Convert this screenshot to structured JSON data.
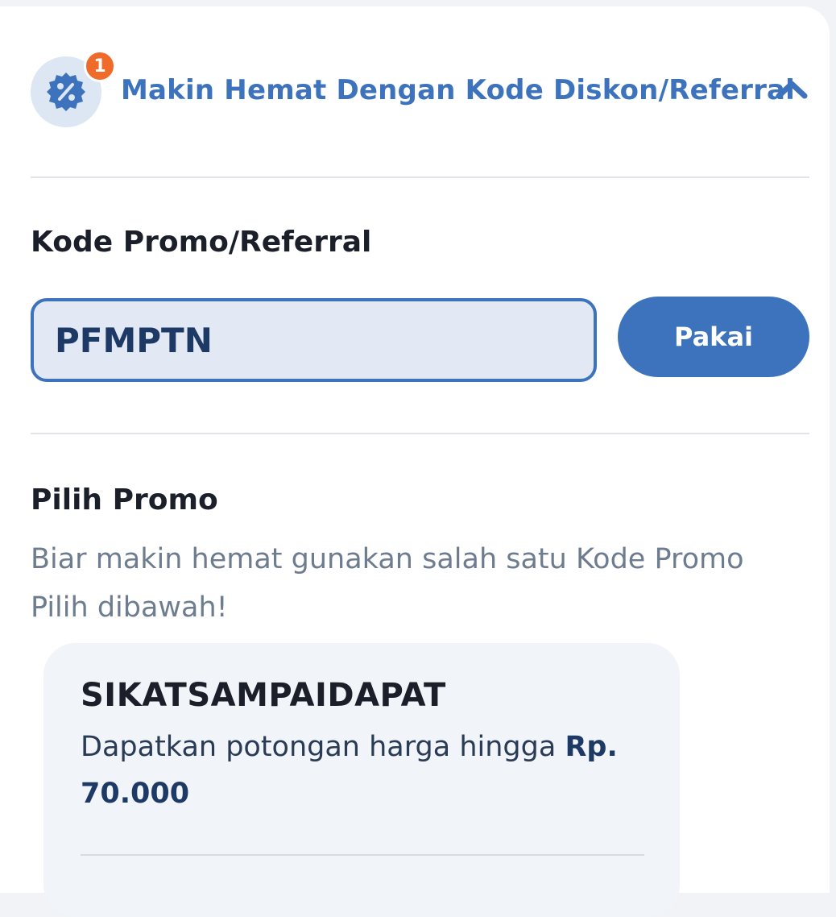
{
  "header": {
    "badge_count": "1",
    "title": "Makin Hemat Dengan Kode Diskon/Referral",
    "icon": "discount-percent-icon",
    "toggle_icon": "chevron-up-icon"
  },
  "promo_form": {
    "label": "Kode Promo/Referral",
    "input_value": "PFMPTN",
    "apply_label": "Pakai"
  },
  "promo_list": {
    "title": "Pilih Promo",
    "description": "Biar makin hemat gunakan salah satu Kode Promo Pilih dibawah!",
    "items": [
      {
        "code": "SIKATSAMPAIDAPAT",
        "description_prefix": "Dapatkan potongan harga hingga",
        "amount": "Rp. 70.000"
      }
    ]
  },
  "colors": {
    "accent": "#3d72bd",
    "badge": "#f06a2a",
    "input_bg": "#e2e9f4",
    "muted_text": "#6e7c8f"
  }
}
